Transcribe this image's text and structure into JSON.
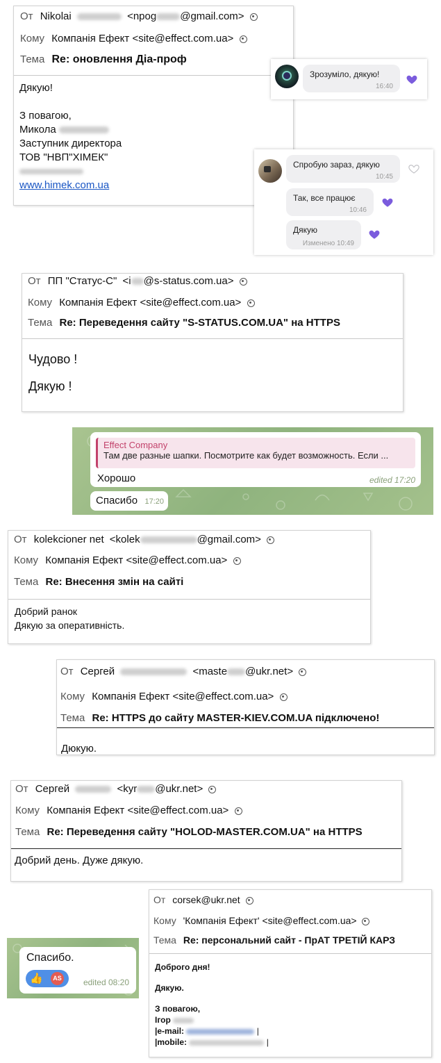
{
  "labels": {
    "from": "От",
    "to": "Кому",
    "subject": "Тема"
  },
  "email1": {
    "from_name": "Nikolai",
    "from_email_start": "<npog",
    "from_email_end": "@gmail.com>",
    "to": "Компанія Ефект <site@effect.com.ua>",
    "subject": "Re: оновлення Діа-проф",
    "body": [
      "Дякую!",
      "З повагою,",
      "Микола",
      "Заступник директора",
      "ТОВ \"НВП\"ХІМЕК\""
    ],
    "link": "www.himek.com.ua"
  },
  "viber1": {
    "text": "Зрозуміло, дякую!",
    "time": "16:40"
  },
  "viber2": {
    "messages": [
      {
        "text": "Спробую зараз, дякую",
        "time": "10:45"
      },
      {
        "text": "Так, все працює",
        "time": "10:46"
      },
      {
        "text": "Дякую",
        "time": "Изменено 10:49"
      }
    ]
  },
  "email2": {
    "from_name": "ПП \"Статус-С\"",
    "from_email_start": "<i",
    "from_email_end": "@s-status.com.ua>",
    "to": "Компанія Ефект <site@effect.com.ua>",
    "subject": "Re: Переведення сайту \"S-STATUS.COM.UA\" на HTTPS",
    "body": [
      "Чудово !",
      "Дякую !"
    ]
  },
  "telegram1": {
    "reply_author": "Effect Company",
    "reply_text": "Там две разные шапки. Посмотрите как будет возможность. Если ...",
    "message": "Хорошо",
    "meta": "edited 17:20",
    "message2": "Спасибо",
    "time2": "17:20"
  },
  "email3": {
    "from_name": "kolekcioner net",
    "from_email_start": "<kolek",
    "from_email_end": "@gmail.com>",
    "to": "Компанія Ефект <site@effect.com.ua>",
    "subject": "Re: Внесення змін на сайті",
    "body": [
      "Добрий ранок",
      "Дякую за оперативність."
    ]
  },
  "email4": {
    "from_name": "Сергей",
    "from_email_start": "<maste",
    "from_email_end": "@ukr.net>",
    "to": "Компанія Ефект <site@effect.com.ua>",
    "subject": "Re: HTTPS до сайту MASTER-KIEV.COM.UA підключено!",
    "body": "Дюкую."
  },
  "email5": {
    "from_name": "Сергей",
    "from_email_start": "<kyr",
    "from_email_end": "@ukr.net>",
    "to": "Компанія Ефект <site@effect.com.ua>",
    "subject": "Re: Переведення сайту \"HOLOD-MASTER.COM.UA\" на HTTPS",
    "body": "Добрий день. Дуже дякую."
  },
  "email6": {
    "from": "corsek@ukr.net",
    "to": "'Компанія Ефект' <site@effect.com.ua>",
    "subject": "Re: персональний сайт - ПрАТ ТРЕТІЙ КАРЗ",
    "body": [
      "Доброго дня!",
      "Дякую.",
      "З повагою,",
      "Ігор",
      "|e-mail:",
      "|mobile:"
    ]
  },
  "telegram2": {
    "message": "Спасибо.",
    "meta": "edited 08:20",
    "reaction_avatar": "AS",
    "reaction_emoji": "👍"
  },
  "colors": {
    "viber_heart": "#7b5cdd",
    "link": "#1a56c4",
    "tg_reply_accent": "#c2426b"
  }
}
